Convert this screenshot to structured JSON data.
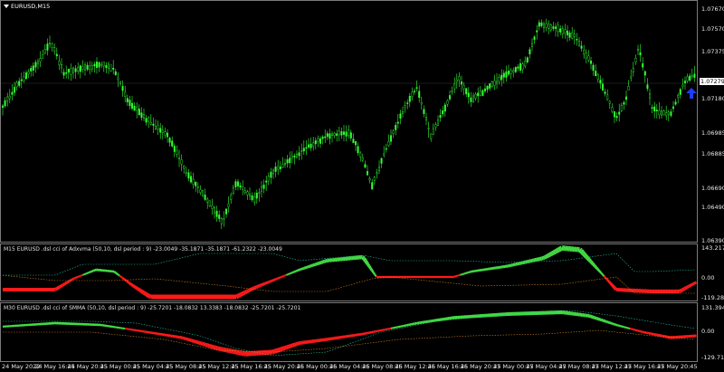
{
  "window": {
    "symbol_label": "EURUSD,M15",
    "current_price": "1.07279"
  },
  "price_axis": {
    "ticks": [
      "1.07670",
      "1.07570",
      "1.07375",
      "1.07180",
      "1.06985",
      "1.06885",
      "1.06690",
      "1.06490",
      "1.06390"
    ]
  },
  "indicator1": {
    "label": "M15 EURUSD .dsl cci of Adxvma (50,10, dsl period : 9) -23.0049 -35.1871 -35.1871 -61.2322 -23.0049",
    "ticks": [
      "143.2179",
      "0.00",
      "-119.2802"
    ]
  },
  "indicator2": {
    "label": "M30 EURUSD .dsl cci of SMMA (50,10, dsl period : 9) -25.7201 -18.0832 13.3383 -18.0832 -25.7201 -25.7201",
    "ticks": [
      "131.3943",
      "0.00",
      "-129.7165"
    ]
  },
  "time_axis": {
    "ticks": [
      "24 May 2022",
      "24 May 16:45",
      "24 May 20:45",
      "25 May 00:45",
      "25 May 04:45",
      "25 May 08:45",
      "25 May 12:45",
      "25 May 16:45",
      "25 May 20:45",
      "26 May 00:45",
      "26 May 04:45",
      "26 May 08:45",
      "26 May 12:45",
      "26 May 16:45",
      "26 May 20:45",
      "27 May 00:45",
      "27 May 04:45",
      "27 May 08:45",
      "27 May 12:45",
      "27 May 16:45",
      "27 May 20:45"
    ]
  },
  "colors": {
    "candle": "#33ff33",
    "bull": "#44dd44",
    "bear": "#ff1a1a",
    "level_up": "#20c0a0",
    "level_dn": "#d08020",
    "arrow": "#1e3cff"
  },
  "icons": {
    "signal": "up-arrow-icon",
    "symbol_menu": "triangle-down-icon"
  }
}
